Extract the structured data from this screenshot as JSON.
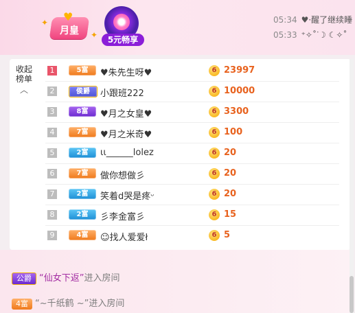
{
  "header": {
    "badge_moon_label": "月皇",
    "badge_five_label": "5元畅享"
  },
  "messages": [
    {
      "time": "05:34",
      "text": "♥·醒了继续睡"
    },
    {
      "time": "05:33",
      "text": "⁺✧˚ᐝ☽ ☾✧˚"
    }
  ],
  "ranking": {
    "collapse_label": "收起榜单",
    "rows": [
      {
        "rank": "1",
        "level": "5富",
        "level_color": "orange",
        "name": "♥朱先生呀♥",
        "amount": "23997"
      },
      {
        "rank": "2",
        "level": "侯爵",
        "level_color": "hou",
        "name": "小跟班222",
        "amount": "10000"
      },
      {
        "rank": "3",
        "level": "8富",
        "level_color": "purple",
        "name": "♥月之女皇♥",
        "amount": "3300"
      },
      {
        "rank": "4",
        "level": "7富",
        "level_color": "orange",
        "name": "♥月之米奇♥",
        "amount": "100"
      },
      {
        "rank": "5",
        "level": "2富",
        "level_color": "blue",
        "name": "ιι______lolez",
        "amount": "20"
      },
      {
        "rank": "6",
        "level": "7富",
        "level_color": "orange",
        "name": "做你想做彡",
        "amount": "20"
      },
      {
        "rank": "7",
        "level": "2富",
        "level_color": "blue",
        "name": "笑着d哭是疼ᵕ",
        "amount": "20"
      },
      {
        "rank": "8",
        "level": "2富",
        "level_color": "blue",
        "name": "彡李金富彡",
        "amount": "15"
      },
      {
        "rank": "9",
        "level": "4富",
        "level_color": "orange",
        "name": "☺找人爱爱ł",
        "amount": "5"
      }
    ],
    "coin_symbol": "6"
  },
  "feed": [
    {
      "tag": "公爵",
      "tag_style": "gong",
      "nick": "“仙女下返”",
      "text": "进入房间"
    },
    {
      "tag": "4富",
      "tag_style": "orange",
      "nick": "“~千纸鹤 ~”",
      "text": "进入房间"
    }
  ]
}
